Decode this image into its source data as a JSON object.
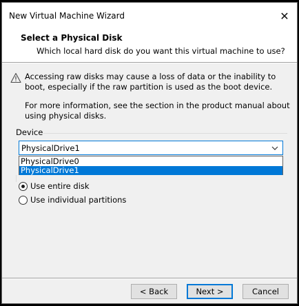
{
  "window": {
    "title": "New Virtual Machine Wizard",
    "close_glyph": "✕"
  },
  "header": {
    "title": "Select a Physical Disk",
    "subtitle": "Which local hard disk do you want this virtual machine to use?"
  },
  "warning": {
    "text": "Accessing raw disks may cause a loss of data or the inability to boot, especially if the raw partition is used as the boot device.",
    "info": "For more information, see the section in the product manual about using physical disks."
  },
  "device": {
    "label": "Device",
    "selected": "PhysicalDrive1",
    "options": [
      "PhysicalDrive0",
      "PhysicalDrive1"
    ],
    "highlighted_option": "PhysicalDrive1"
  },
  "usage": {
    "options": [
      {
        "label": "Use entire disk",
        "checked": true
      },
      {
        "label": "Use individual partitions",
        "checked": false
      }
    ]
  },
  "buttons": {
    "back": "< Back",
    "next": "Next >",
    "cancel": "Cancel"
  },
  "colors": {
    "accent": "#0078d7",
    "background": "#f0f0f0",
    "header": "#ffffff"
  }
}
